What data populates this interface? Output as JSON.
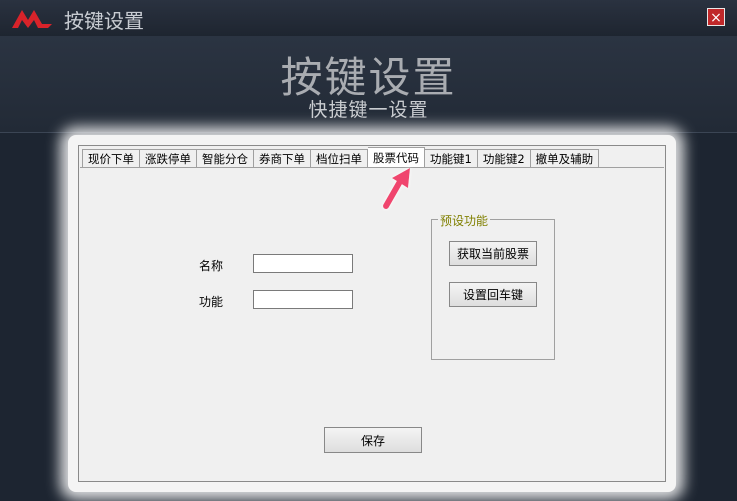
{
  "window": {
    "title": "按键设置",
    "close_label": "×"
  },
  "header": {
    "title": "按键设置",
    "subtitle": "快捷键一设置"
  },
  "tabs": [
    {
      "label": "现价下单",
      "active": false
    },
    {
      "label": "涨跌停单",
      "active": false
    },
    {
      "label": "智能分仓",
      "active": false
    },
    {
      "label": "券商下单",
      "active": false
    },
    {
      "label": "档位扫单",
      "active": false
    },
    {
      "label": "股票代码",
      "active": true
    },
    {
      "label": "功能键1",
      "active": false
    },
    {
      "label": "功能键2",
      "active": false
    },
    {
      "label": "撤单及辅助",
      "active": false
    }
  ],
  "form": {
    "name_label": "名称",
    "name_value": "",
    "func_label": "功能",
    "func_value": ""
  },
  "preset": {
    "title": "预设功能",
    "btn_get_stock": "获取当前股票",
    "btn_set_enter": "设置回车键"
  },
  "save_label": "保存",
  "colors": {
    "accent_arrow": "#f0456e",
    "logo_red": "#d8232a",
    "legend": "#808000"
  }
}
